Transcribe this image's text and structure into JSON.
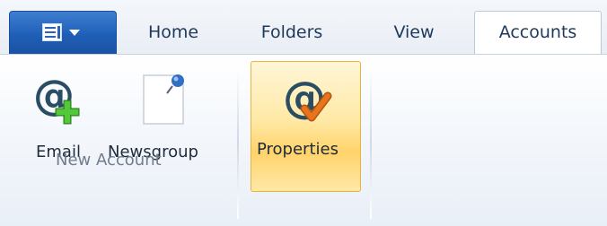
{
  "tabs": [
    "Home",
    "Folders",
    "View",
    "Accounts"
  ],
  "active_tab": "Accounts",
  "file_menu": {
    "icon": "application-menu-icon"
  },
  "ribbon": {
    "groups": [
      {
        "label": "New Account",
        "buttons": [
          {
            "label": "Email",
            "icon": "email-account-add-icon"
          },
          {
            "label": "Newsgroup",
            "icon": "newsgroup-document-icon"
          }
        ]
      },
      {
        "label": "",
        "buttons": [
          {
            "label": "Properties",
            "icon": "account-properties-icon",
            "state": "hover"
          }
        ]
      }
    ]
  },
  "colors": {
    "file_button": "#2a63b8",
    "tab_text": "#1e395b",
    "highlight": "#ffd36a",
    "plus_green": "#3fae2a",
    "check_orange": "#e8741c"
  }
}
